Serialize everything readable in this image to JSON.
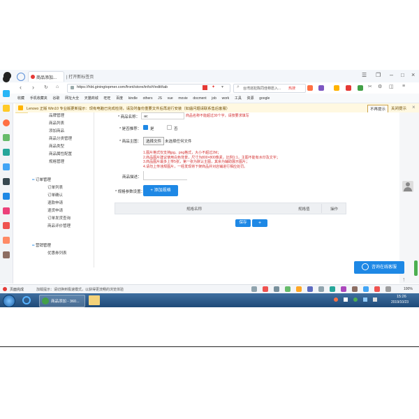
{
  "browser": {
    "tab_title": "商品添加...",
    "tab2_title": "| 打开新标签页",
    "url": "https://hbt.giningtopmer.com/front/store/info/#/edit/tab",
    "search_placeholder": "台湾逃犯陈同佳称愿入...",
    "search_badge": "热搜",
    "bookmarks": [
      "收藏",
      "手机收藏夹",
      "谷歌",
      "网址大全",
      "天猫商城",
      "旺旺",
      "百度",
      "kindle",
      "others",
      "JS",
      "vue",
      "movie",
      "docment",
      "job",
      "work",
      "工具",
      "资源",
      "google"
    ],
    "notice": "Lenovo 正版 Win10 专业版更新提示：现有电脑已完成检测，请及时备份重要文件后再进行安装（如遇问题请联系售后客服）",
    "notice_buttons": [
      "不再提示",
      "关闭提示"
    ]
  },
  "sidebar": {
    "groups": [
      {
        "items": [
          "品牌管理",
          "商品列表",
          "添加商品",
          "商品分类管理",
          "商品类型",
          "商品属性配置",
          "规格管理"
        ]
      },
      {
        "head": "订单管理",
        "items": [
          "订单列表",
          "订单确认",
          "退款申请",
          "退货申请",
          "订单发货查询",
          "商品评价管理"
        ]
      },
      {
        "head": "营销管理",
        "items": [
          "优惠券列表"
        ]
      }
    ]
  },
  "form": {
    "name_label": "* 商品名称：",
    "name_value": "ac",
    "name_hint": "商品名称不能超过30个字，请按要求填写",
    "recommend_label": "* 是否推荐：",
    "recommend_yes": "是",
    "recommend_no": "否",
    "image_label": "* 商品主图：",
    "upload_button": "选择文件",
    "upload_status": "未选择任何文件",
    "rules": [
      "1.图片格式仅支持jpg、png格式，大小不超过2M；",
      "2.商品图片建议使用白色背景，尺寸为800×800像素，比例1:1，主图不能有水印及文字；",
      "3.商品图片最多上传5张，第一张为默认主图，其余为辅助展示图片；",
      "4.请勿上传违规图片，一经发现将下架商品并对店铺进行相应处罚。"
    ],
    "desc_label": "商品描述：",
    "spec_label": "* 规格参数设置：",
    "add_spec_button": "+ 添加规格",
    "table_headers": [
      "规格名称",
      "规格值",
      "操作"
    ],
    "save_button": "保存",
    "add_button": "+"
  },
  "chat_button": "咨询在线客服",
  "statusbar": {
    "left": "页面完成",
    "middle": "加载提示：请切换到极速模式，以获得更流畅的浏览体验",
    "zoom": "100%"
  },
  "taskbar": {
    "app1": "商品添加 - 360...",
    "time": "15:26",
    "date": "2019/10/23"
  },
  "colors": {
    "accent": "#1e88e5",
    "warning": "#d32f2f",
    "notice_bg": "#fff8e1"
  }
}
